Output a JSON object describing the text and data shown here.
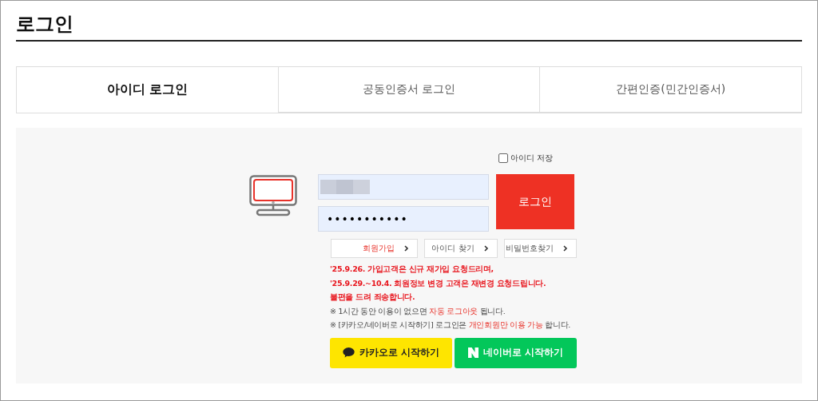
{
  "page_title": "로그인",
  "tabs": [
    {
      "label": "아이디 로그인",
      "selected": true
    },
    {
      "label": "공동인증서 로그인",
      "selected": false
    },
    {
      "label": "간편인증(민간인증서)",
      "selected": false
    }
  ],
  "remember_id": {
    "label": "아이디 저장",
    "checked": false
  },
  "password": {
    "masked_value": "•••••••••••"
  },
  "login_button": "로그인",
  "links": [
    {
      "label": "회원가입",
      "highlight": true
    },
    {
      "label": "아이디 찾기",
      "highlight": false
    },
    {
      "label": "비밀번호찾기",
      "highlight": false
    }
  ],
  "notices": [
    {
      "kind": "alert",
      "parts": [
        {
          "text": "'25.9.26. 가입고객은 신규 재가입 요청드리며,",
          "emphasized": false
        }
      ]
    },
    {
      "kind": "alert",
      "parts": [
        {
          "text": "'25.9.29.~10.4. 회원정보 변경 고객은 재변경 요청드립니다.",
          "emphasized": false
        }
      ]
    },
    {
      "kind": "alert",
      "parts": [
        {
          "text": "불편을 드려 죄송합니다.",
          "emphasized": false
        }
      ]
    },
    {
      "kind": "info",
      "parts": [
        {
          "text": "※ 1시간 동안 이용이 없으면 ",
          "emphasized": false
        },
        {
          "text": "자동 로그아웃",
          "emphasized": true
        },
        {
          "text": " 됩니다.",
          "emphasized": false
        }
      ]
    },
    {
      "kind": "info",
      "parts": [
        {
          "text": "※ [카카오/네이버로 시작하기]  로그인은 ",
          "emphasized": false
        },
        {
          "text": "개인회원만 이용 가능",
          "emphasized": true
        },
        {
          "text": " 합니다.",
          "emphasized": false
        }
      ]
    }
  ],
  "social": [
    {
      "kind": "kakao",
      "label": "카카오로 시작하기"
    },
    {
      "kind": "naver",
      "label": "네이버로 시작하기"
    }
  ]
}
